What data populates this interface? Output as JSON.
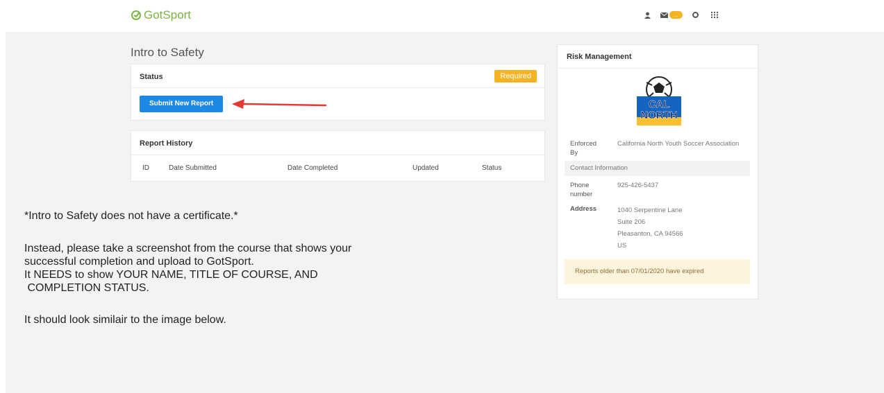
{
  "app": {
    "logo_text": "GotSport"
  },
  "topbar": {
    "mail_badge": "..."
  },
  "page": {
    "title": "Intro to Safety"
  },
  "status_card": {
    "header": "Status",
    "badge": "Required",
    "submit_label": "Submit New Report"
  },
  "history_card": {
    "header": "Report History",
    "columns": [
      "ID",
      "Date Submitted",
      "Date Completed",
      "Updated",
      "Status"
    ]
  },
  "risk": {
    "header": "Risk Management",
    "enforced_label": "Enforced By",
    "enforced_value": "California North Youth Soccer Association",
    "contact_label": "Contact Information",
    "phone_label": "Phone number",
    "phone_value": "925-426-5437",
    "address_label": "Address",
    "address_lines": [
      "1040 Serpentine Lane",
      "Suite 206",
      "Pleasanton, CA 94566",
      "US"
    ],
    "expired_note": "Reports older than 07/01/2020 have expired",
    "crest": {
      "line1": "CAL",
      "line2": "NORTH"
    }
  },
  "notes": [
    "*Intro to Safety does not have a certificate.*",
    "Instead, please take a screenshot from the course that shows your",
    "successful completion and upload to GotSport.",
    "It NEEDS to show YOUR NAME, TITLE OF COURSE, AND",
    " COMPLETION STATUS.",
    "It should look similair to the image below."
  ],
  "colors": {
    "brand": "#7cb342",
    "primary": "#1e88e5",
    "warning": "#f5b324",
    "arrow": "#e53935"
  }
}
